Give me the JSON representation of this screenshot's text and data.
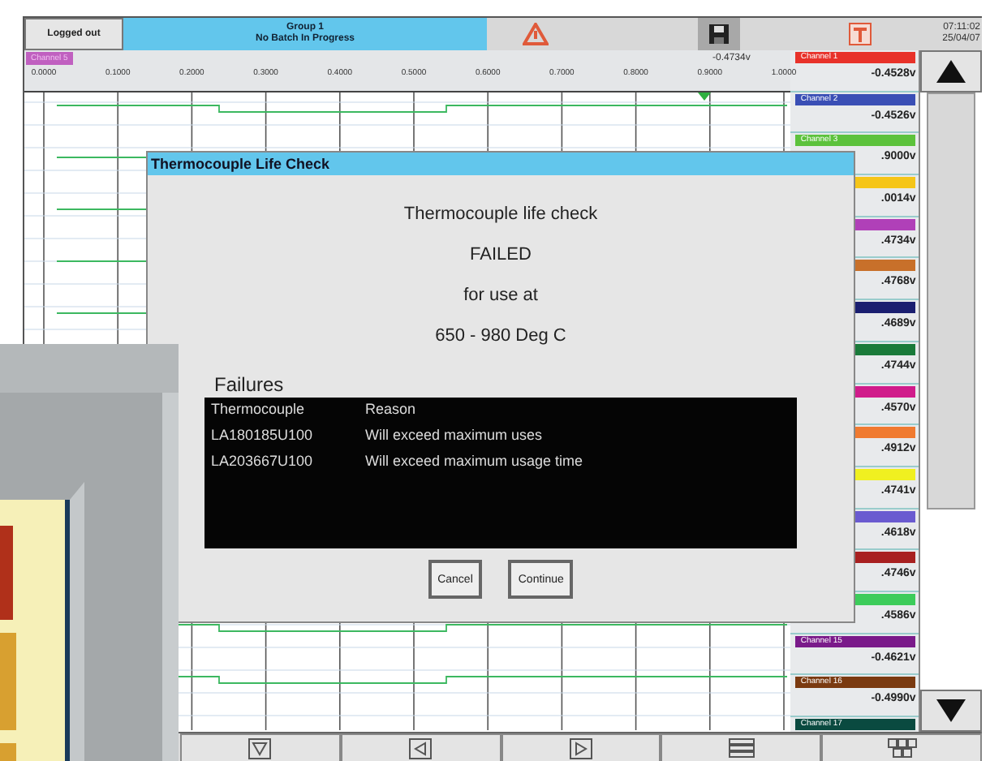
{
  "top_bar": {
    "login_button": "Logged out",
    "group": "Group 1",
    "batch_status": "No Batch In Progress",
    "time": "07:11:02",
    "date": "25/04/07"
  },
  "scale": {
    "channel_tag": "Channel 5",
    "ticks": [
      "0.0000",
      "0.1000",
      "0.2000",
      "0.3000",
      "0.4000",
      "0.5000",
      "0.6000",
      "0.7000",
      "0.8000",
      "0.9000",
      "1.0000"
    ],
    "cursor_reading": "-0.4734v"
  },
  "channels": [
    {
      "name": "Channel 1",
      "color": "#e8322a",
      "reading": "-0.4528v"
    },
    {
      "name": "Channel 2",
      "color": "#3a4fb5",
      "reading": "-0.4526v"
    },
    {
      "name": "Channel 3",
      "color": "#5cc23c",
      "reading": ".9000v"
    },
    {
      "color": "#f5c518",
      "reading": ".0014v"
    },
    {
      "color": "#b040b8",
      "reading": ".4734v"
    },
    {
      "color": "#c8702a",
      "reading": ".4768v"
    },
    {
      "color": "#1a1e70",
      "reading": ".4689v"
    },
    {
      "color": "#1a7a3a",
      "reading": ".4744v"
    },
    {
      "color": "#d01c8b",
      "reading": ".4570v"
    },
    {
      "color": "#f07a30",
      "reading": ".4912v"
    },
    {
      "color": "#f0f020",
      "reading": ".4741v"
    },
    {
      "color": "#6a5ad0",
      "reading": ".4618v"
    },
    {
      "color": "#a82020",
      "reading": ".4746v"
    },
    {
      "color": "#3ccc5a",
      "reading": ".4586v"
    },
    {
      "name": "Channel 15",
      "color": "#7a1a8a",
      "reading": "-0.4621v"
    },
    {
      "name": "Channel 16",
      "color": "#7a3a10",
      "reading": "-0.4990v"
    },
    {
      "name": "Channel 17",
      "color": "#0a4a40"
    }
  ],
  "dialog": {
    "title": "Thermocouple Life Check",
    "lines": [
      "Thermocouple life check",
      "FAILED",
      "for use at",
      "650 - 980 Deg C"
    ],
    "failures_label": "Failures",
    "columns": [
      "Thermocouple",
      "Reason"
    ],
    "rows": [
      [
        "LA180185U100",
        "Will exceed maximum uses"
      ],
      [
        "LA203667U100",
        "Will exceed maximum usage time"
      ]
    ],
    "buttons": [
      "Cancel",
      "Continue"
    ]
  },
  "bottom_buttons": [
    {
      "kind": "down"
    },
    {
      "kind": "left"
    },
    {
      "kind": "right"
    },
    {
      "kind": "menu"
    },
    {
      "kind": "grid"
    }
  ]
}
